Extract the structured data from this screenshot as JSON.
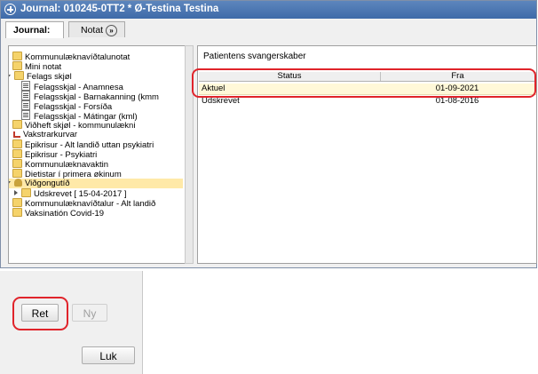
{
  "window": {
    "title": "Journal: 010245-0TT2 * Ø-Testina Testina"
  },
  "tabs": [
    {
      "label": "Journal:"
    },
    {
      "label": "Notat"
    }
  ],
  "tree": {
    "items": [
      {
        "label": "Kommunulæknavíðtalunotat",
        "icon": "folder-icon"
      },
      {
        "label": "Mini notat",
        "icon": "folder-icon"
      },
      {
        "label": "Felags skjøl",
        "icon": "folder-icon"
      },
      {
        "label": "Felagsskjal - Anamnesa",
        "icon": "document-icon"
      },
      {
        "label": "Felagsskjal - Barnakanning (kmm",
        "icon": "document-icon"
      },
      {
        "label": "Felagsskjal - Forsíða",
        "icon": "document-icon"
      },
      {
        "label": "Felagsskjal - Mátingar (kml)",
        "icon": "document-icon"
      },
      {
        "label": "Viðheft skjøl - kommunulækni",
        "icon": "folder-icon"
      },
      {
        "label": "Vakstrarkurvar",
        "icon": "chart-icon"
      },
      {
        "label": "Epikrisur - Alt landið uttan psykiatri",
        "icon": "folder-icon"
      },
      {
        "label": "Epikrisur - Psykiatri",
        "icon": "folder-icon"
      },
      {
        "label": "Kommunulæknavaktin",
        "icon": "folder-icon"
      },
      {
        "label": "Dietistar í primera økinum",
        "icon": "folder-icon"
      },
      {
        "label": "Viðgongutíð",
        "icon": "person-folder-icon"
      },
      {
        "label": "Udskrevet [ 15-04-2017 ]",
        "icon": "folder-icon"
      },
      {
        "label": "Kommunulæknavíðtalur - Alt landið",
        "icon": "folder-icon"
      },
      {
        "label": "Vaksinatión Covid-19",
        "icon": "folder-icon"
      }
    ]
  },
  "panel": {
    "title": "Patientens svangerskaber",
    "columns": [
      "Status",
      "Fra"
    ],
    "rows": [
      {
        "status": "Aktuel",
        "fra": "01-09-2021"
      },
      {
        "status": "Udskrevet",
        "fra": "01-08-2016"
      }
    ]
  },
  "buttons": {
    "ret": "Ret",
    "ny": "Ny",
    "luk": "Luk"
  },
  "colors": {
    "titlebar": "#3e6aa8",
    "highlight": "#e0242b",
    "selection": "#ffe9a8"
  }
}
